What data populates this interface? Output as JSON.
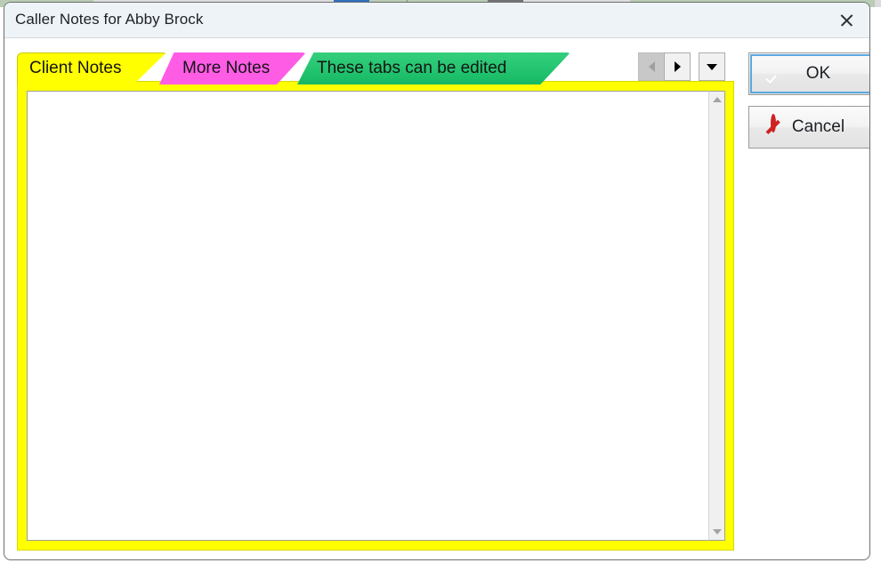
{
  "window": {
    "title": "Caller Notes for Abby Brock",
    "close_label": "Close"
  },
  "tabs": {
    "items": [
      {
        "label": "Client Notes",
        "color": "#ffff00",
        "active": true
      },
      {
        "label": "More Notes",
        "color": "#ff5ce6",
        "active": false
      },
      {
        "label": "These tabs can be edited",
        "color": "#23c46f",
        "active": false
      }
    ],
    "nav": {
      "prev_label": "Previous tab",
      "next_label": "Next tab",
      "list_label": "Tab list"
    }
  },
  "notes": {
    "value": "",
    "placeholder": ""
  },
  "scrollbar": {
    "up_label": "Scroll up",
    "down_label": "Scroll down"
  },
  "buttons": {
    "ok": "OK",
    "cancel": "Cancel"
  },
  "colors": {
    "accent_yellow": "#ffff00",
    "accent_magenta": "#ff5ce6",
    "accent_green": "#23c46f",
    "ok_icon": "#32a961",
    "cancel_icon": "#cf2222",
    "focus_ring": "#5ba8e0",
    "titlebar": "#eef3f7"
  }
}
